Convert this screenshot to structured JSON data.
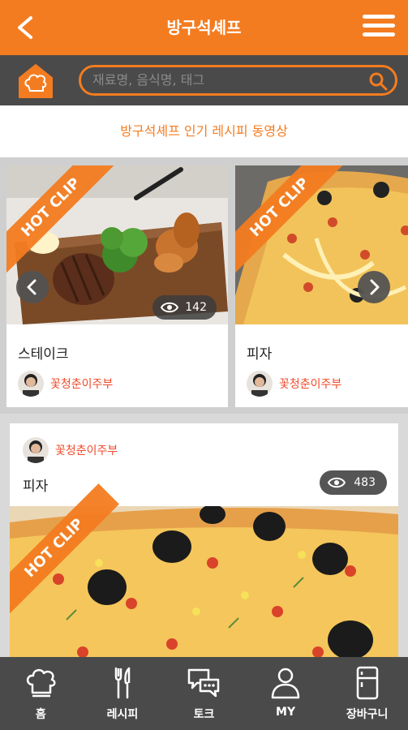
{
  "header": {
    "title": "방구석셰프",
    "back_icon": "back-arrow-icon",
    "menu_icon": "hamburger-menu-icon"
  },
  "search": {
    "placeholder": "재료명, 음식명, 태그",
    "home_icon": "chef-hat-home-icon",
    "search_icon": "search-icon"
  },
  "section": {
    "title": "방구석셰프 인기 레시피 동영상"
  },
  "carousel": {
    "items": [
      {
        "badge": "HOT CLIP",
        "title": "스테이크",
        "author": "꽃청춘이주부",
        "views": "142"
      },
      {
        "badge": "HOT CLIP",
        "title": "피자",
        "author": "꽃청춘이주부",
        "views": ""
      }
    ]
  },
  "feed": [
    {
      "author": "꽃청춘이주부",
      "title": "피자",
      "views": "483",
      "badge": "HOT CLIP"
    }
  ],
  "bottom_nav": [
    {
      "label": "홈",
      "icon": "chef-hat-icon"
    },
    {
      "label": "레시피",
      "icon": "fork-knife-icon"
    },
    {
      "label": "토크",
      "icon": "chat-bubbles-icon"
    },
    {
      "label": "MY",
      "icon": "person-icon"
    },
    {
      "label": "장바구니",
      "icon": "fridge-icon"
    }
  ],
  "colors": {
    "accent": "#f47c20",
    "dark": "#4a4a4a",
    "author": "#f04a2a"
  }
}
